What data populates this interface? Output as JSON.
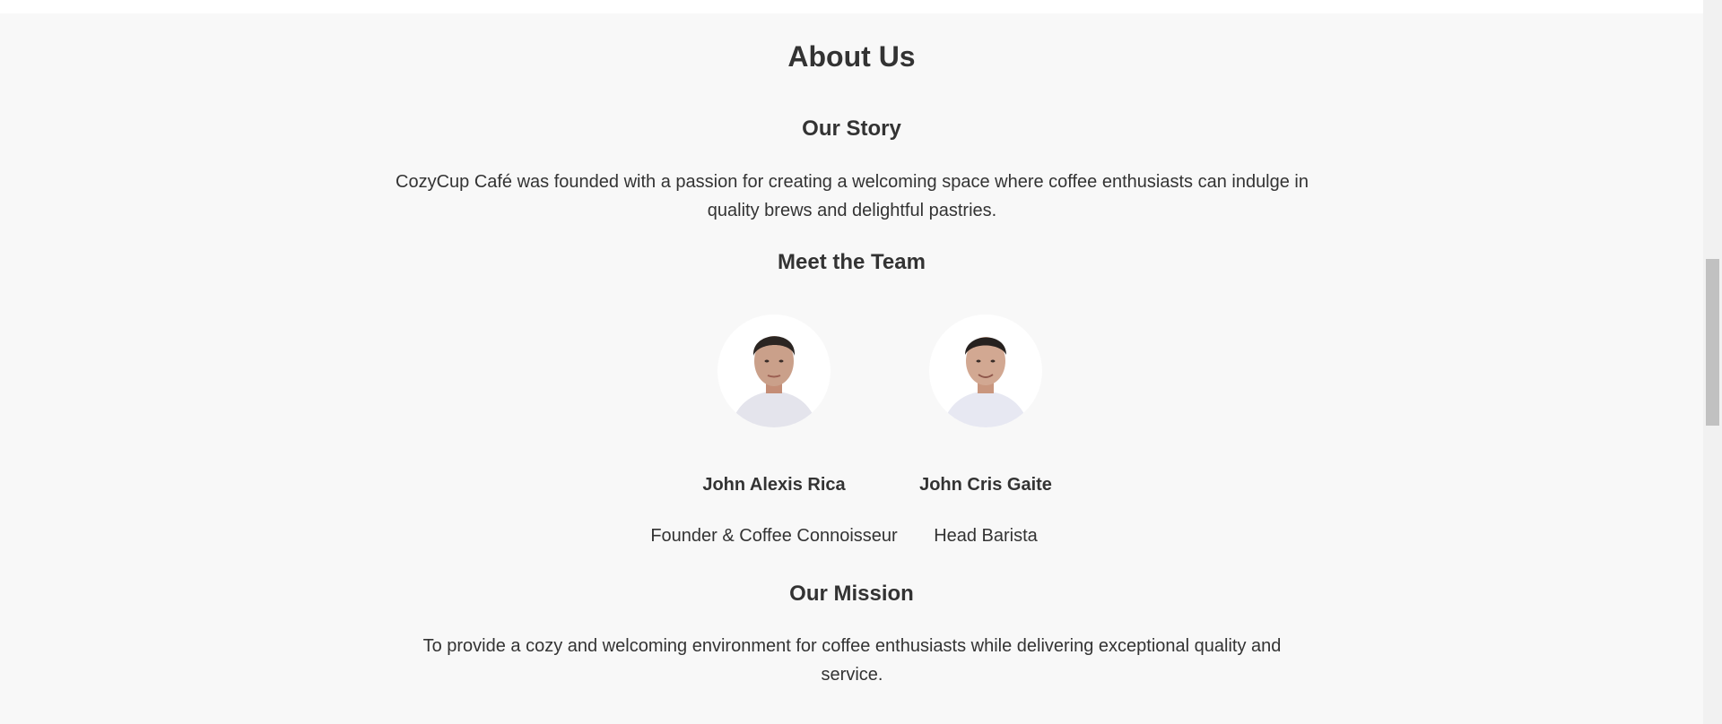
{
  "about": {
    "title": "About Us",
    "story": {
      "heading": "Our Story",
      "text": "CozyCup Café was founded with a passion for creating a welcoming space where coffee enthusiasts can indulge in quality brews and delightful pastries."
    },
    "team": {
      "heading": "Meet the Team",
      "members": [
        {
          "name": "John Alexis Rica",
          "role": "Founder & Coffee Connoisseur"
        },
        {
          "name": "John Cris Gaite",
          "role": "Head Barista"
        }
      ]
    },
    "mission": {
      "heading": "Our Mission",
      "text": "To provide a cozy and welcoming environment for coffee enthusiasts while delivering exceptional quality and service."
    }
  },
  "colors": {
    "section_bg": "#f8f8f8",
    "text": "#333333",
    "scroll_thumb": "#c1c1c1"
  }
}
